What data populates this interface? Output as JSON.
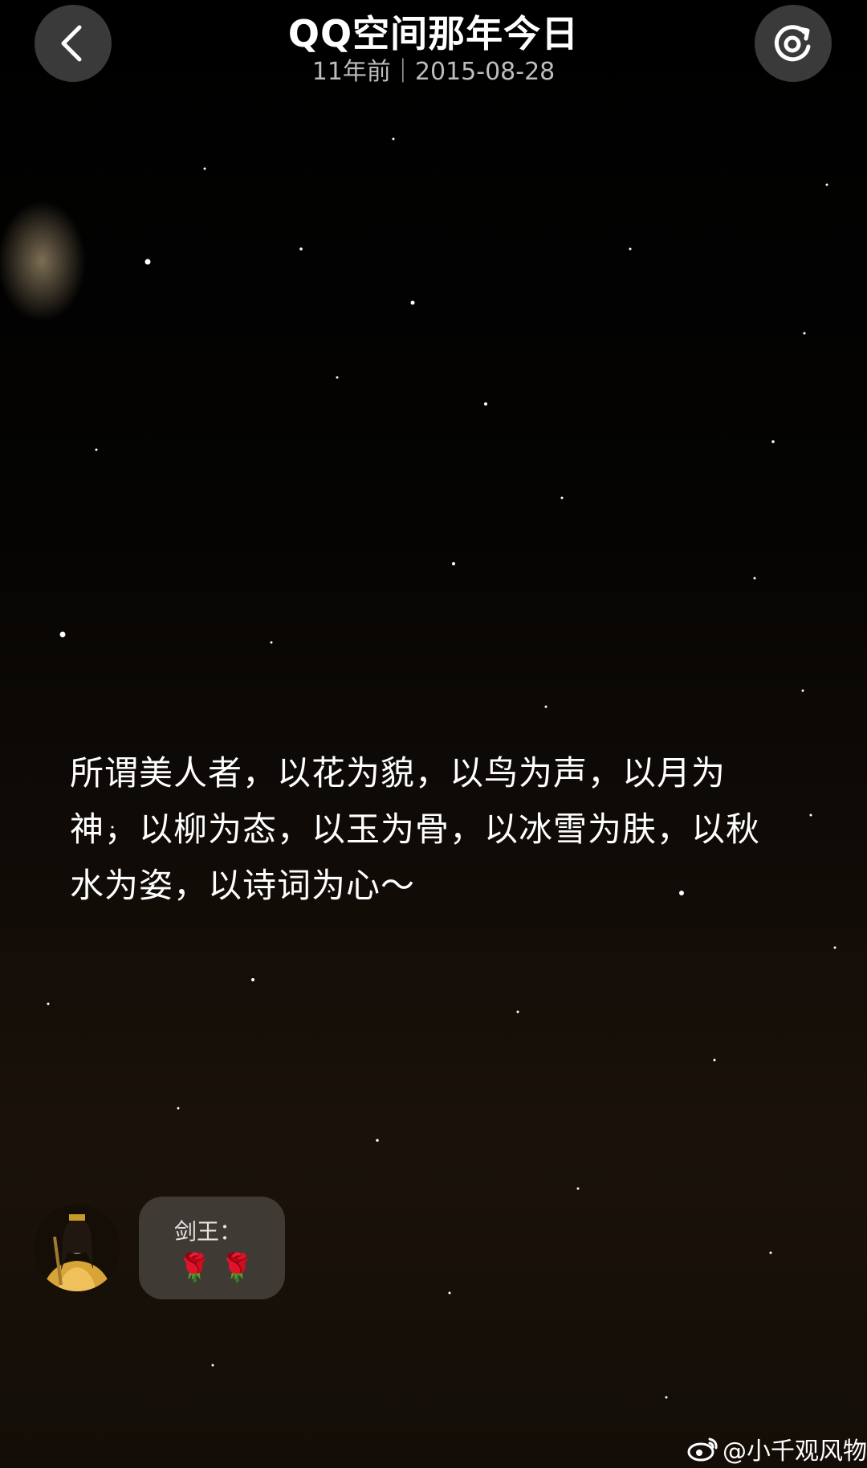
{
  "header": {
    "title": "QQ空间那年今日",
    "subtitle": "11年前｜2015-08-28"
  },
  "icons": {
    "back": "chevron-left-icon",
    "replay": "replay-target-icon"
  },
  "content": {
    "poem": "所谓美人者，以花为貌，以鸟为声，以月为神，以柳为态，以玉为骨，以冰雪为肤，以秋水为姿，以诗词为心～"
  },
  "comment": {
    "name": "剑王：",
    "emoji": "🌹 🌹"
  },
  "watermark": {
    "text": "@小千观风物"
  },
  "colors": {
    "button_bg": "#3a3a3a",
    "text_primary": "#ffffff",
    "text_secondary": "#bdbdbd"
  }
}
